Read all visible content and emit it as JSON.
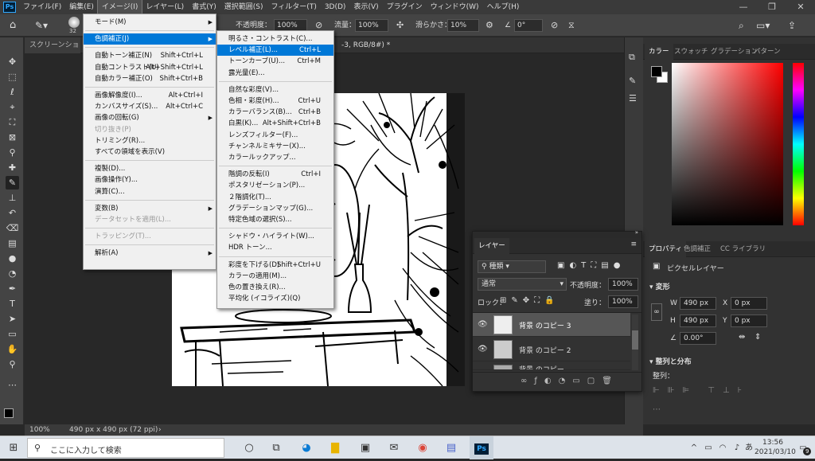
{
  "menubar": {
    "items": [
      "ファイル(F)",
      "編集(E)",
      "イメージ(I)",
      "レイヤー(L)",
      "書式(Y)",
      "選択範囲(S)",
      "フィルター(T)",
      "3D(D)",
      "表示(V)",
      "プラグイン",
      "ウィンドウ(W)",
      "ヘルプ(H)"
    ],
    "logo": "Ps",
    "window_controls": [
      "—",
      "❐",
      "✕"
    ]
  },
  "options_bar": {
    "brush_size": "32",
    "opacity_label": "不透明度：",
    "opacity_value": "100%",
    "flow_label": "流量：",
    "flow_value": "100%",
    "smoothing_label": "滑らかさ：",
    "smoothing_value": "10%",
    "angle_value": "0°"
  },
  "document": {
    "tab_left": "スクリーンショット (",
    "tab_right": "-3, RGB/8#) *",
    "zoom": "100%",
    "size_info": "490 px x 490 px (72 ppi)"
  },
  "image_menu": {
    "items": [
      {
        "label": "モード(M)",
        "sub": true
      },
      {
        "sep": true
      },
      {
        "label": "色調補正(J)",
        "sub": true,
        "hl": true
      },
      {
        "sep": true
      },
      {
        "label": "自動トーン補正(N)",
        "sc": "Shift+Ctrl+L"
      },
      {
        "label": "自動コントラスト(U)",
        "sc": "Alt+Shift+Ctrl+L"
      },
      {
        "label": "自動カラー補正(O)",
        "sc": "Shift+Ctrl+B"
      },
      {
        "sep": true
      },
      {
        "label": "画像解像度(I)...",
        "sc": "Alt+Ctrl+I"
      },
      {
        "label": "カンバスサイズ(S)...",
        "sc": "Alt+Ctrl+C"
      },
      {
        "label": "画像の回転(G)",
        "sub": true
      },
      {
        "label": "切り抜き(P)",
        "dis": true
      },
      {
        "label": "トリミング(R)..."
      },
      {
        "label": "すべての領域を表示(V)"
      },
      {
        "sep": true
      },
      {
        "label": "複製(D)..."
      },
      {
        "label": "画像操作(Y)..."
      },
      {
        "label": "演算(C)..."
      },
      {
        "sep": true
      },
      {
        "label": "変数(B)",
        "sub": true
      },
      {
        "label": "データセットを適用(L)...",
        "dis": true
      },
      {
        "sep": true
      },
      {
        "label": "トラッピング(T)...",
        "dis": true
      },
      {
        "sep": true
      },
      {
        "label": "解析(A)",
        "sub": true
      }
    ]
  },
  "adjust_menu": {
    "items": [
      {
        "label": "明るさ・コントラスト(C)..."
      },
      {
        "label": "レベル補正(L)...",
        "sc": "Ctrl+L",
        "hl": true
      },
      {
        "label": "トーンカーブ(U)...",
        "sc": "Ctrl+M"
      },
      {
        "label": "露光量(E)..."
      },
      {
        "sep": true
      },
      {
        "label": "自然な彩度(V)..."
      },
      {
        "label": "色相・彩度(H)...",
        "sc": "Ctrl+U"
      },
      {
        "label": "カラーバランス(B)...",
        "sc": "Ctrl+B"
      },
      {
        "label": "白黒(K)...",
        "sc": "Alt+Shift+Ctrl+B"
      },
      {
        "label": "レンズフィルター(F)..."
      },
      {
        "label": "チャンネルミキサー(X)..."
      },
      {
        "label": "カラールックアップ..."
      },
      {
        "sep": true
      },
      {
        "label": "階調の反転(I)",
        "sc": "Ctrl+I"
      },
      {
        "label": "ポスタリゼーション(P)..."
      },
      {
        "label": "２階調化(T)..."
      },
      {
        "label": "グラデーションマップ(G)..."
      },
      {
        "label": "特定色域の選択(S)..."
      },
      {
        "sep": true
      },
      {
        "label": "シャドウ・ハイライト(W)..."
      },
      {
        "label": "HDR トーン..."
      },
      {
        "sep": true
      },
      {
        "label": "彩度を下げる(D)",
        "sc": "Shift+Ctrl+U"
      },
      {
        "label": "カラーの適用(M)..."
      },
      {
        "label": "色の置き換え(R)..."
      },
      {
        "label": "平均化 (イコライズ)(Q)"
      }
    ]
  },
  "color_panel": {
    "tabs": [
      "カラー",
      "スウォッチ",
      "グラデーション",
      "パターン"
    ],
    "hue": "#ff0000"
  },
  "props_panel": {
    "tabs": [
      "プロパティ",
      "色調補正",
      "CC ライブラリ"
    ],
    "layer_type": "ピクセルレイヤー",
    "transform_label": "変形",
    "w_label": "W",
    "w_value": "490 px",
    "h_label": "H",
    "h_value": "490 px",
    "x_label": "X",
    "x_value": "0 px",
    "y_label": "Y",
    "y_value": "0 px",
    "angle_value": "0.00°",
    "align_label": "整列と分布",
    "align_sub": "整列："
  },
  "layers_panel": {
    "title": "レイヤー",
    "filter": "種類",
    "blend": "通常",
    "opacity_label": "不透明度：",
    "opacity_value": "100%",
    "lock_label": "ロック：",
    "fill_label": "塗り：",
    "fill_value": "100%",
    "layers": [
      "背景 のコピー 3",
      "背景 のコピー 2",
      "背景 のコピー"
    ]
  },
  "taskbar": {
    "search_placeholder": "ここに入力して検索",
    "time": "13:56",
    "date": "2021/03/10",
    "lang": "あ",
    "notif": "9"
  }
}
